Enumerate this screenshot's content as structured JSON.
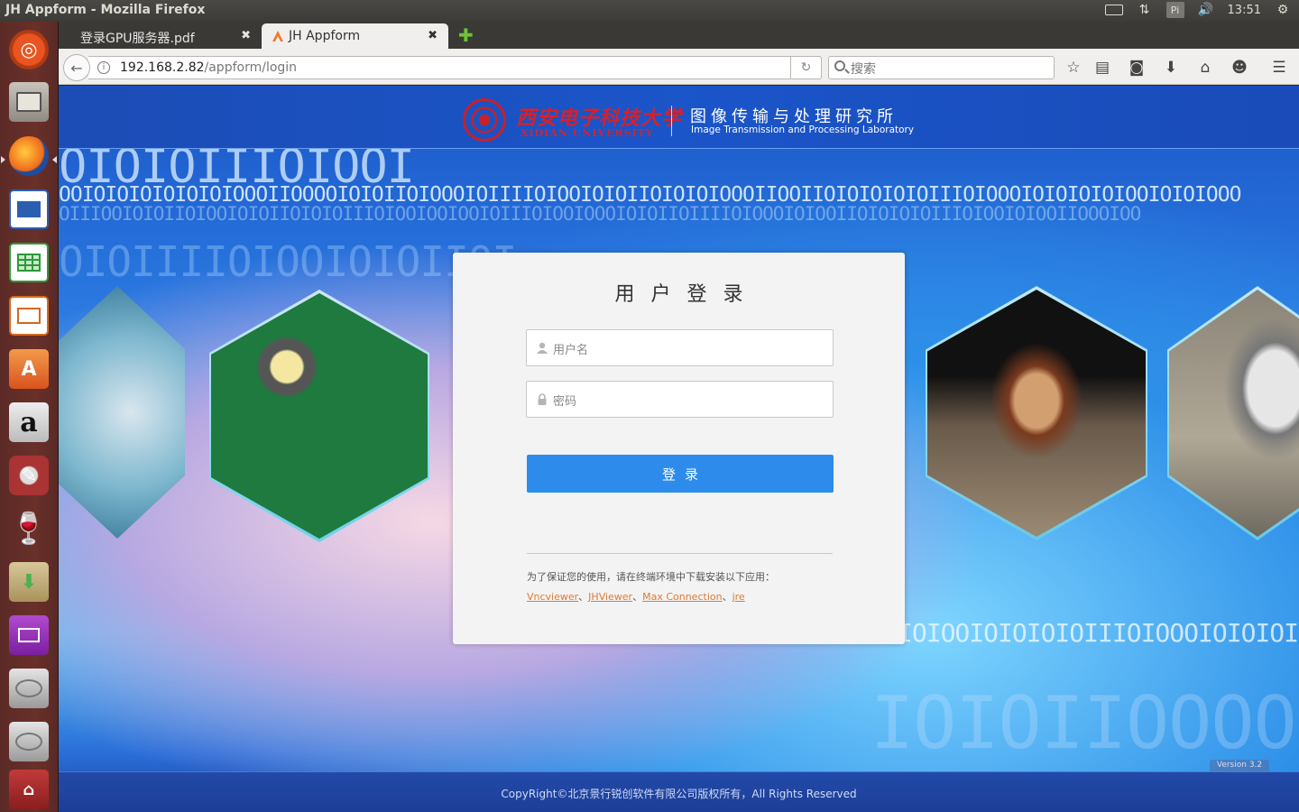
{
  "window": {
    "title": "JH Appform - Mozilla Firefox"
  },
  "top_panel": {
    "clock": "13:51",
    "pi_label": "Pi"
  },
  "tabs": [
    {
      "label": "登录GPU服务器.pdf",
      "close": "✖"
    },
    {
      "label": "JH Appform",
      "close": "✖"
    }
  ],
  "new_tab": "✚",
  "navbar": {
    "url_host": "192.168.2.82",
    "url_path": "/appform/login",
    "search_placeholder": "搜索"
  },
  "header": {
    "university_cn": "西安电子科技大学",
    "university_en": "XIDIAN UNIVERSITY",
    "lab_cn": "图像传输与处理研究所",
    "lab_en": "Image Transmission and Processing Laboratory"
  },
  "background_binary": {
    "row1": "OIOIOIIIOIOOI",
    "row2": "OOIOIOIOIOIOIOIOOOIIOOOOIOIOIIOIOOOIOIIIIOIOOIOIOIIOIOIOIOOOIIOOIIOIOIOIOIOIIIOIOOOIOIOIOIOIOOIOIOIOOO",
    "row3": "OIIIOOIOIOIIOIOOIOIOIIOIOIOIIIOIOOIOOIOOIOIIIOIOOIOOOIOIOIIOIIIIOIOOOIOIOOIIOIOIOIOIIIOIOOIOIOOIIOOOIOO",
    "row4": "OIOIIIIOIOOIOIOIIOI",
    "row5": "IOIOOIOIOIOIOIIIOIOOOIOIOIOIO",
    "row6": "IOIOIIOOOOIOIOII"
  },
  "login": {
    "title": "用户登录",
    "username_placeholder": "用户名",
    "password_placeholder": "密码",
    "submit_label": "登录",
    "notice_prefix": "为了保证您的使用，请在终端环境中下载安装以下应用：",
    "links": [
      "Vncviewer",
      "JHViewer",
      "Max Connection",
      "jre"
    ],
    "separator": "、"
  },
  "version": "Version 3.2",
  "footer": "CopyRight©北京景行锐创软件有限公司版权所有，All Rights Reserved",
  "colors": {
    "primary_button": "#2d8ceb",
    "header_blue": "#1a55c9",
    "link_orange": "#e07a30",
    "university_red": "#d8202a"
  },
  "launcher_icons": [
    "ubuntu-dash-icon",
    "files-icon",
    "firefox-icon",
    "writer-icon",
    "calc-icon",
    "impress-icon",
    "software-center-icon",
    "amazon-icon",
    "system-settings-icon",
    "wine-icon",
    "archive-manager-icon",
    "remote-desktop-icon",
    "drive-icon",
    "drive-icon",
    "usb-drive-icon"
  ]
}
